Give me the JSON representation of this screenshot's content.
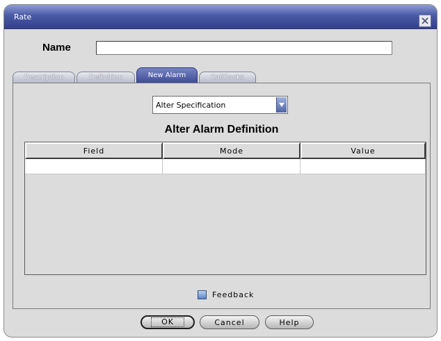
{
  "window": {
    "title": "Rate",
    "close_icon": "close-icon"
  },
  "name_field": {
    "label": "Name",
    "value": ""
  },
  "tabs": [
    {
      "label": "Description",
      "active": false
    },
    {
      "label": "Definition",
      "active": false
    },
    {
      "label": "New Alarm",
      "active": true
    },
    {
      "label": "CallBacks",
      "active": false
    }
  ],
  "alarm": {
    "type_select": {
      "value": "Alter Specification"
    },
    "section_title": "Alter Alarm Definition",
    "table": {
      "columns": [
        "Field",
        "Mode",
        "Value"
      ],
      "rows": [
        [
          "",
          "",
          ""
        ]
      ]
    },
    "feedback": {
      "label": "Feedback",
      "checked": true
    }
  },
  "buttons": {
    "ok": "OK",
    "cancel": "Cancel",
    "help": "Help"
  },
  "colors": {
    "title_bar": "#4a5aa6",
    "active_tab": "#4f5ca8",
    "background": "#dcdcdc"
  }
}
